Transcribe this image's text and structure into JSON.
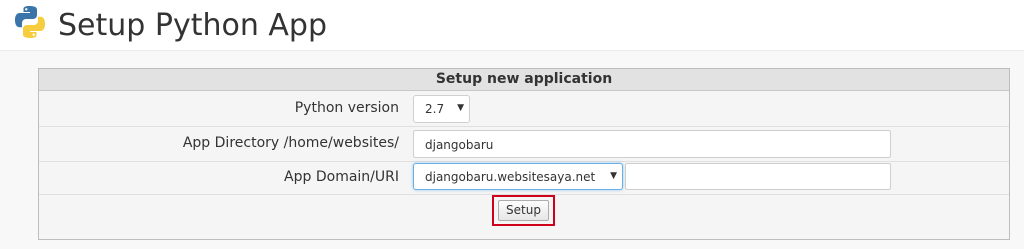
{
  "header": {
    "title": "Setup Python App",
    "logo_icon": "python-logo-icon"
  },
  "panel": {
    "title": "Setup new application",
    "python_version": {
      "label": "Python version",
      "value": "2.7"
    },
    "app_directory": {
      "label": "App Directory /home/websites/",
      "value": "djangobaru"
    },
    "app_domain": {
      "label": "App Domain/URI",
      "domain_value": "djangobaru.websitesaya.net",
      "uri_value": ""
    },
    "setup_button_label": "Setup"
  },
  "colors": {
    "highlight_border": "#d0021b",
    "focus_border": "#66afe9"
  }
}
